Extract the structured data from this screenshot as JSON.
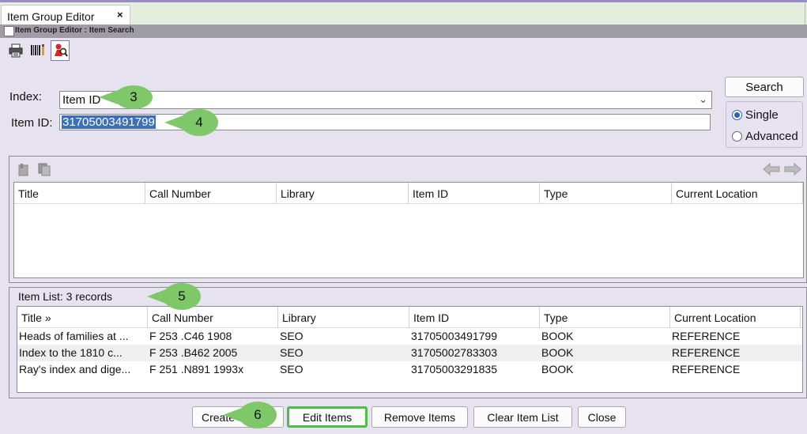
{
  "tab": {
    "title": "Item Group Editor",
    "close": "×"
  },
  "breadcrumb": "Item Group Editor : Item Search",
  "toolbar": {
    "print_icon": "printer-icon",
    "barcode_icon": "barcode-icon",
    "search_icon": "person-search-icon"
  },
  "search": {
    "index_label": "Index:",
    "index_value": "Item ID",
    "itemid_label": "Item ID:",
    "itemid_value": "31705003491799",
    "search_button": "Search",
    "mode_single": "Single",
    "mode_advanced": "Advanced",
    "selected_mode": "Single"
  },
  "results": {
    "columns": [
      "Title",
      "Call Number",
      "Library",
      "Item ID",
      "Type",
      "Current Location"
    ]
  },
  "item_list": {
    "heading": "Item List: 3 records",
    "columns": [
      "Title »",
      "Call Number",
      "Library",
      "Item ID",
      "Type",
      "Current Location"
    ],
    "rows": [
      [
        "Heads of families at ...",
        "F 253 .C46 1908",
        "SEO",
        "31705003491799",
        "BOOK",
        "REFERENCE"
      ],
      [
        "Index to the 1810 c...",
        "F 253 .B462 2005",
        "SEO",
        "31705002783303",
        "BOOK",
        "REFERENCE"
      ],
      [
        "Ray's index and dige...",
        "F 251 .N891 1993x",
        "SEO",
        "31705003291835",
        "BOOK",
        "REFERENCE"
      ]
    ]
  },
  "buttons": {
    "create": "Create",
    "edit_items": "Edit Items",
    "remove_items": "Remove Items",
    "clear_item_list": "Clear Item List",
    "close": "Close"
  },
  "callouts": [
    "3",
    "4",
    "5",
    "6"
  ],
  "colors": {
    "accent": "#2d62b8",
    "callout": "#7ec86a",
    "highlight": "#4cbf4a",
    "selection": "#3d6fb6"
  }
}
